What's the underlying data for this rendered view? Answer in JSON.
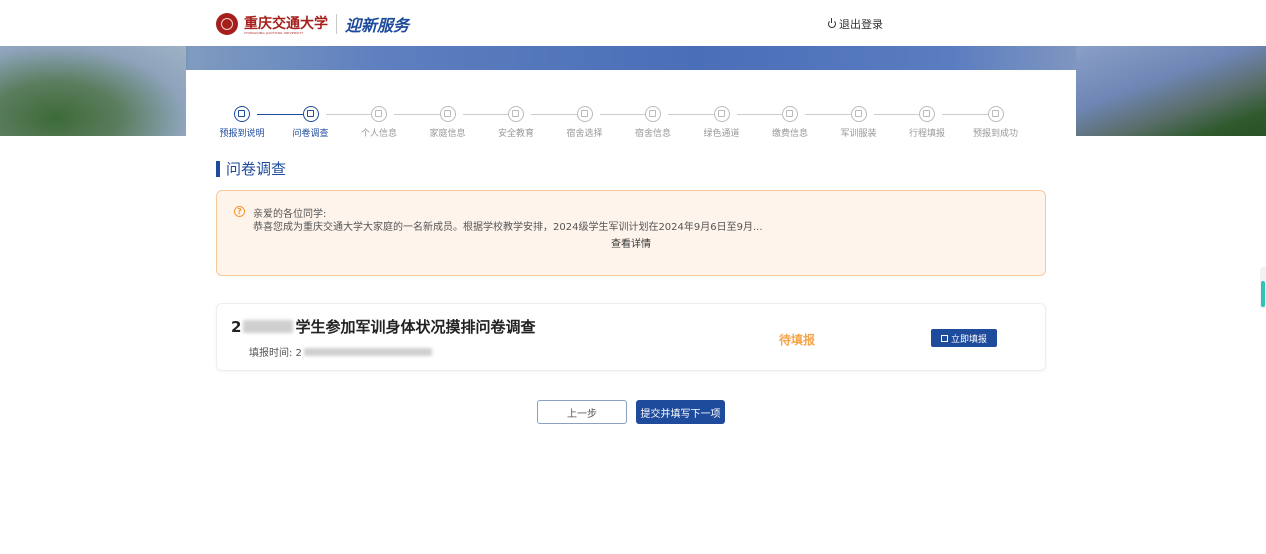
{
  "header": {
    "logo_cn": "重庆交通大学",
    "logo_en": "CHONGQING JIAOTONG UNIVERSITY",
    "service_name": "迎新服务",
    "logout_label": "退出登录"
  },
  "steps": [
    {
      "label": "预报到说明",
      "state": "done"
    },
    {
      "label": "问卷调查",
      "state": "current"
    },
    {
      "label": "个人信息",
      "state": "todo"
    },
    {
      "label": "家庭信息",
      "state": "todo"
    },
    {
      "label": "安全教育",
      "state": "todo"
    },
    {
      "label": "宿舍选择",
      "state": "todo"
    },
    {
      "label": "宿舍信息",
      "state": "todo"
    },
    {
      "label": "绿色通道",
      "state": "todo"
    },
    {
      "label": "缴费信息",
      "state": "todo"
    },
    {
      "label": "军训服装",
      "state": "todo"
    },
    {
      "label": "行程填报",
      "state": "todo"
    },
    {
      "label": "预报到成功",
      "state": "todo"
    }
  ],
  "section_title": "问卷调查",
  "notice": {
    "line1": "亲爱的各位同学:",
    "line2": "恭喜您成为重庆交通大学大家庭的一名新成员。根据学校教学安排，2024级学生军训计划在2024年9月6日至9月...",
    "more_label": "查看详情"
  },
  "survey": {
    "title_prefix": "2",
    "title": "学生参加军训身体状况摸排问卷调查",
    "time_label": "填报时间: 2",
    "status": "待填报",
    "action_label": "立即填报"
  },
  "footer": {
    "prev_label": "上一步",
    "next_label": "提交并填写下一项"
  },
  "colors": {
    "primary": "#1f4b9c",
    "status_pending": "#f5a54a",
    "notice_bg": "#fff4ec",
    "notice_border": "#f6c99b"
  }
}
